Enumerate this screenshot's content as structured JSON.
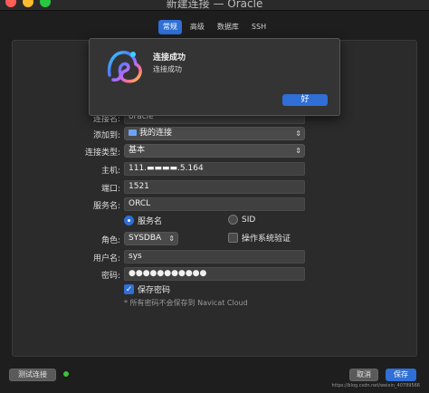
{
  "window": {
    "title": "新建连接 — Oracle"
  },
  "tabs": [
    {
      "label": "常规",
      "active": true
    },
    {
      "label": "高级",
      "active": false
    },
    {
      "label": "数据库",
      "active": false
    },
    {
      "label": "SSH",
      "active": false
    }
  ],
  "form": {
    "conn_name": {
      "label": "连接名:",
      "value": "oracle"
    },
    "add_to": {
      "label": "添加到:",
      "value": "我的连接"
    },
    "conn_type": {
      "label": "连接类型:",
      "value": "基本"
    },
    "host": {
      "label": "主机:",
      "value": "111.▬▬▬▬.5.164"
    },
    "port": {
      "label": "端口:",
      "value": "1521"
    },
    "service": {
      "label": "服务名:",
      "value": "ORCL"
    },
    "radio_service": "服务名",
    "radio_sid": "SID",
    "role": {
      "label": "角色:",
      "value": "SYSDBA"
    },
    "os_auth": "操作系统验证",
    "username": {
      "label": "用户名:",
      "value": "sys"
    },
    "password": {
      "label": "密码:",
      "value": "●●●●●●●●●●●"
    },
    "save_password": "保存密码",
    "note": "* 所有密码不会保存到 Navicat Cloud"
  },
  "footer": {
    "test_button": "测试连接",
    "cancel_button": "取消",
    "save_button": "保存",
    "watermark": "https://blog.csdn.net/weixin_40789566"
  },
  "dialog": {
    "title": "连接成功",
    "message": "连接成功",
    "ok_button": "好"
  },
  "colors": {
    "accent": "#2f6fd6",
    "status_ok": "#3ac33a",
    "traffic_red": "#ff5f57",
    "traffic_yellow": "#febc2e",
    "traffic_green": "#28c840"
  },
  "icons": [
    "navicat-logo-icon",
    "folder-icon",
    "chevron-updown-icon",
    "checkmark-icon"
  ]
}
